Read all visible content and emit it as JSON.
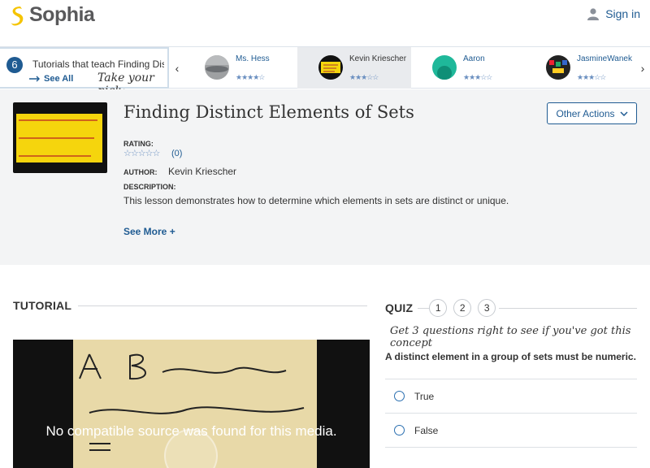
{
  "header": {
    "brand": "Sophia",
    "signin_label": "Sign in",
    "colors": {
      "brand_mark": "#f5c400",
      "link": "#1f5b92"
    }
  },
  "tutorial_bar": {
    "count": "6",
    "text": "Tutorials that teach Finding Distinct Elements of Sets",
    "see_all": "See All",
    "pick_text": "Take your pick:",
    "prev_icon": "chevron-left-icon",
    "next_icon": "chevron-right-icon",
    "tutors": [
      {
        "name": "Ms. Hess",
        "stars": "★★★★☆"
      },
      {
        "name": "Kevin Kriescher",
        "stars": "★★★☆☆"
      },
      {
        "name": "Aaron",
        "stars": "★★★☆☆"
      },
      {
        "name": "JasmineWanek",
        "stars": "★★★☆☆"
      }
    ]
  },
  "lesson": {
    "title": "Finding Distinct Elements of Sets",
    "other_actions": "Other Actions",
    "rating_label": "RATING:",
    "rating_stars": "☆☆☆☆☆",
    "rating_count": "(0)",
    "author_label": "AUTHOR:",
    "author": "Kevin Kriescher",
    "description_label": "DESCRIPTION:",
    "description": "This lesson demonstrates how to determine which elements in sets are distinct or unique.",
    "see_more": "See More +"
  },
  "tutorial": {
    "heading": "TUTORIAL",
    "video_error": "No compatible source was found for this media."
  },
  "quiz": {
    "heading": "QUIZ",
    "numbers": [
      "1",
      "2",
      "3"
    ],
    "prompt": "Get 3 questions right to see if you've got this concept",
    "question": "A distinct element in a group of sets must be numeric.",
    "answers": [
      "True",
      "False"
    ]
  }
}
